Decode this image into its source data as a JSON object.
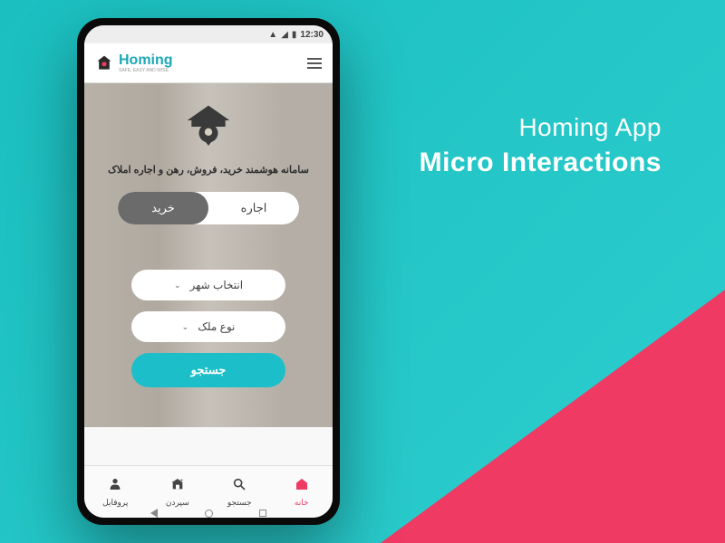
{
  "headline": {
    "line1": "Homing App",
    "line2": "Micro Interactions"
  },
  "status_bar": {
    "time": "12:30"
  },
  "app_header": {
    "brand_name": "Homing",
    "brand_sub": "SAFE, EASY AND WISE"
  },
  "hero": {
    "tagline": "سامانه هوشمند خرید، فروش، رهن و اجاره املاک",
    "toggle": {
      "buy": "خرید",
      "rent": "اجاره"
    },
    "select_city": "انتخاب شهر",
    "property_type": "نوع ملک",
    "search": "جستجو"
  },
  "bottom_nav": {
    "profile": "پروفایل",
    "deposit": "سپردن",
    "search": "جستجو",
    "home": "خانه"
  },
  "colors": {
    "accent": "#1CBFC9",
    "pink": "#EF3A64",
    "teal": "#1BBFC0"
  }
}
